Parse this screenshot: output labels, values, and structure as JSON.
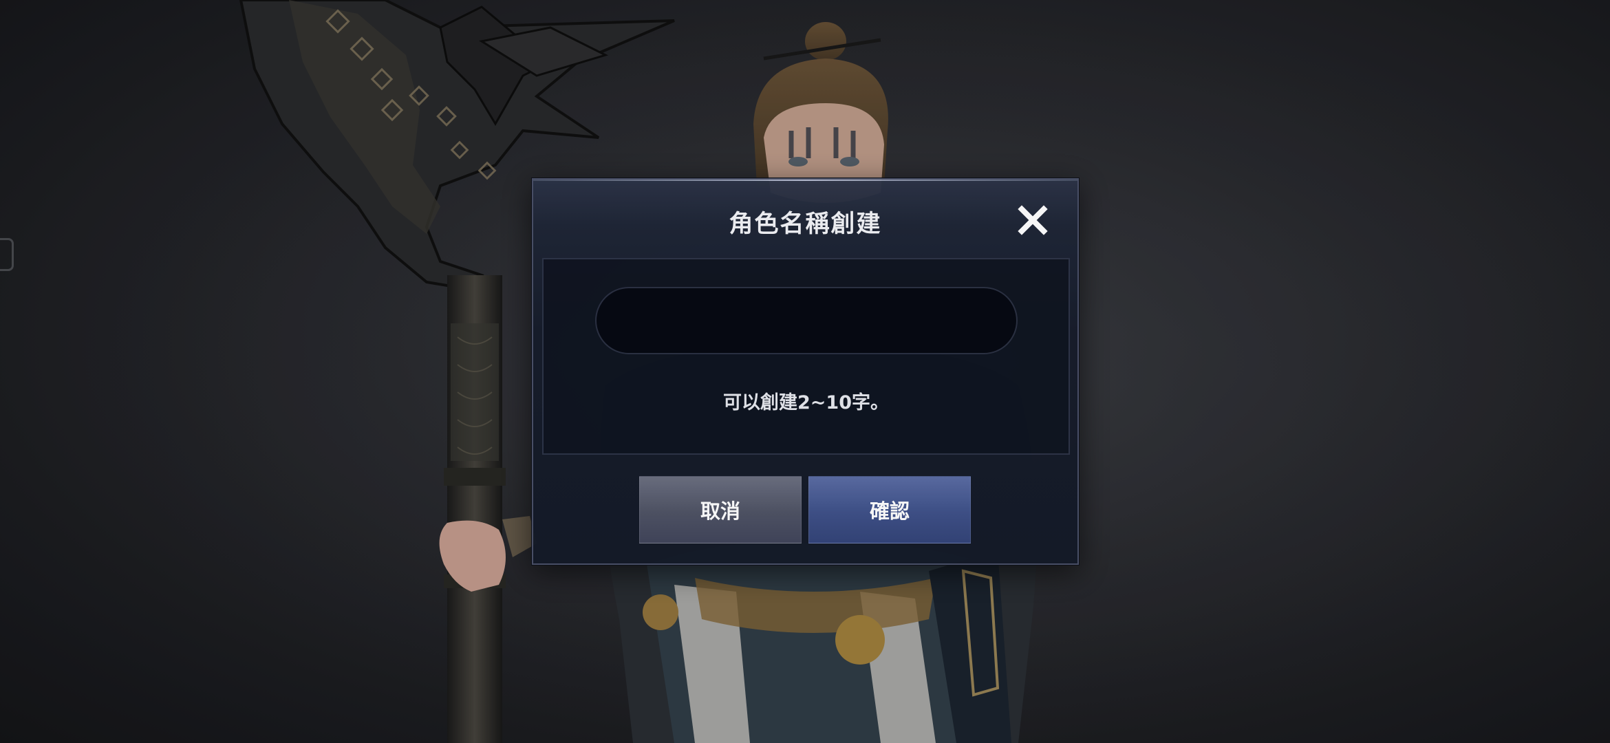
{
  "dialog": {
    "title": "角色名稱創建",
    "name_input": {
      "value": "",
      "placeholder": ""
    },
    "hint": "可以創建2~10字。",
    "cancel_label": "取消",
    "confirm_label": "確認"
  },
  "icons": {
    "close": "close-icon",
    "side_tab": "side-tab-icon"
  },
  "colors": {
    "dialog_bg": "#161c2a",
    "cancel_button": "#4e5264",
    "confirm_button": "#3e5088",
    "text": "#f2f3f7"
  }
}
